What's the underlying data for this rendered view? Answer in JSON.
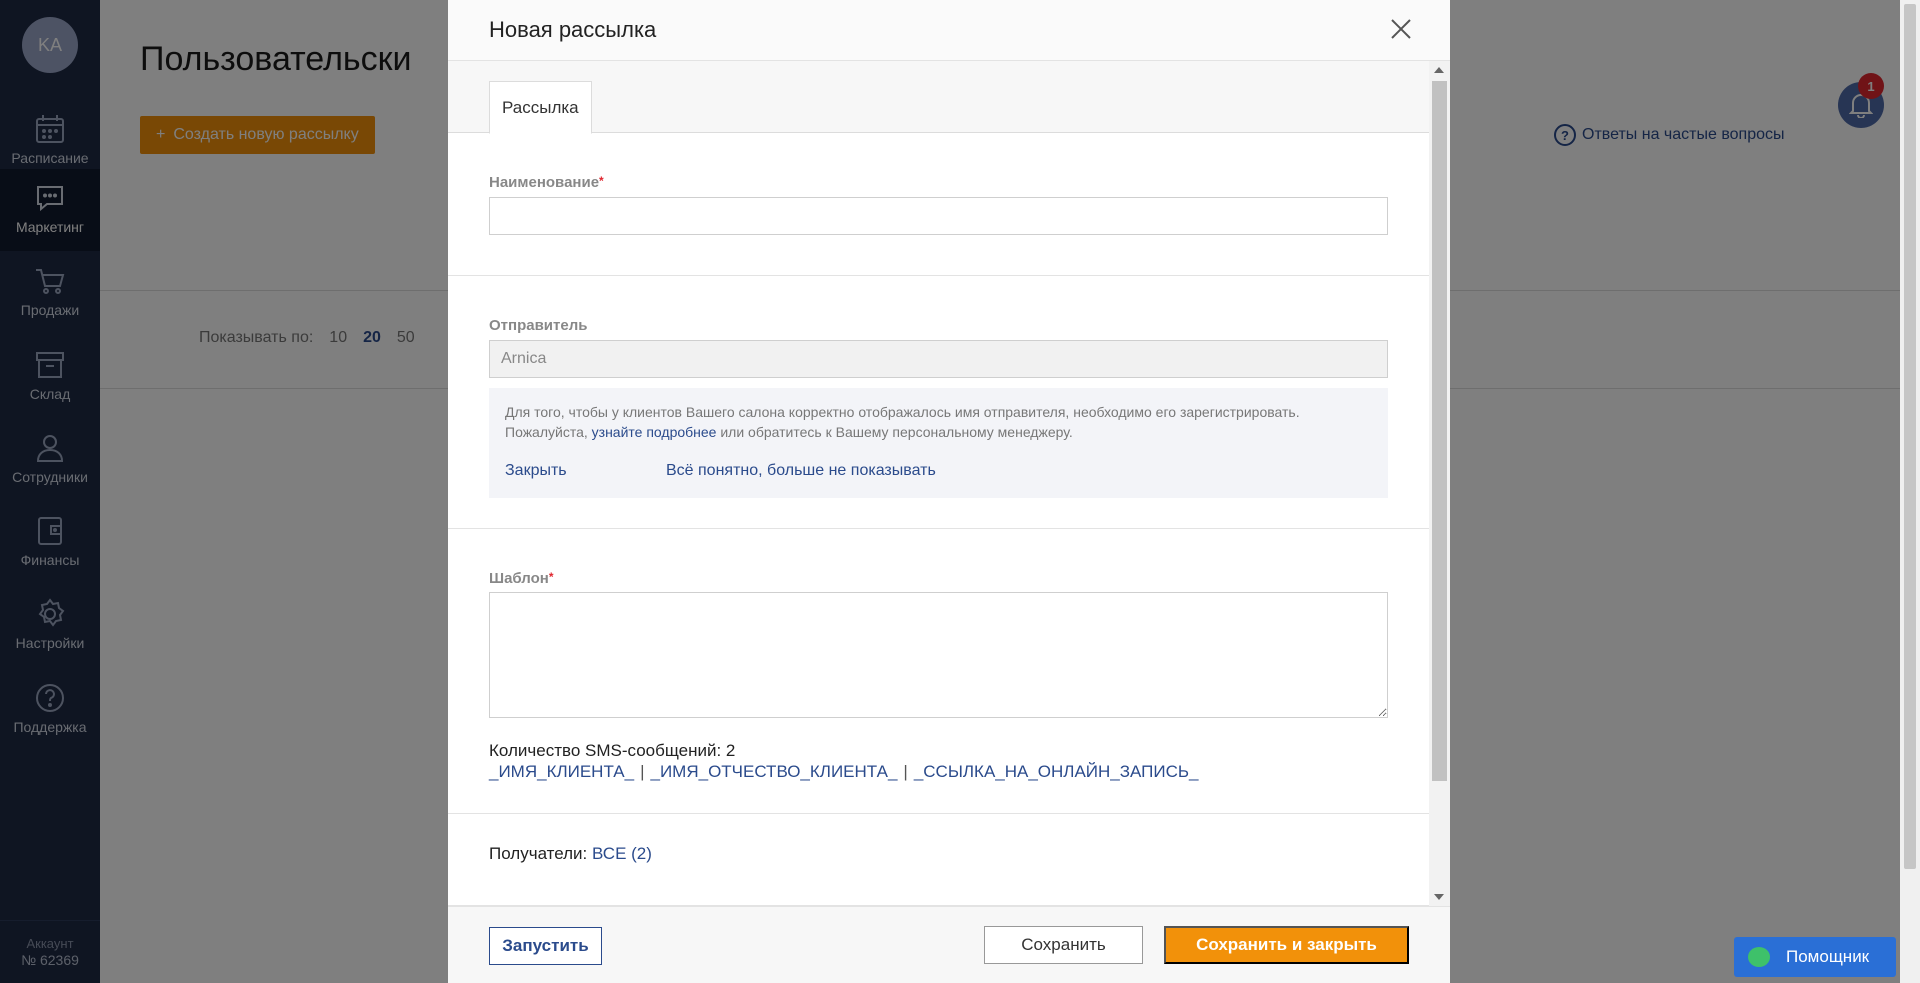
{
  "sidebar": {
    "avatar_initials": "KA",
    "items": [
      {
        "label": "Расписание",
        "icon": "calendar-icon"
      },
      {
        "label": "Маркетинг",
        "icon": "chat-icon",
        "active": true
      },
      {
        "label": "Продажи",
        "icon": "cart-icon"
      },
      {
        "label": "Склад",
        "icon": "box-icon"
      },
      {
        "label": "Сотрудники",
        "icon": "user-icon"
      },
      {
        "label": "Финансы",
        "icon": "wallet-icon"
      },
      {
        "label": "Настройки",
        "icon": "gear-icon"
      },
      {
        "label": "Поддержка",
        "icon": "help-icon"
      }
    ],
    "account_label": "Аккаунт",
    "account_number": "№ 62369"
  },
  "page": {
    "title": "Пользовательски",
    "create_button": "Создать новую рассылку",
    "faq_link": "Ответы на частые вопросы",
    "notification_count": "1",
    "per_page_label": "Показывать по:",
    "per_page_options": [
      "10",
      "20",
      "50"
    ],
    "per_page_selected": "20"
  },
  "modal": {
    "title": "Новая рассылка",
    "tab": "Рассылка",
    "name_label": "Наименование",
    "name_value": "",
    "sender_label": "Отправитель",
    "sender_value": "Arnica",
    "info_text_1": "Для того, чтобы у клиентов Вашего салона корректно отображалось имя отправителя, необходимо его зарегистрировать.",
    "info_text_2_prefix": "Пожалуйста,",
    "info_link": "узнайте подробнее",
    "info_text_2_suffix": "или обратитесь к Вашему персональному менеджеру.",
    "info_close": "Закрыть",
    "info_dismiss": "Всё понятно, больше не показывать",
    "template_label": "Шаблон",
    "template_value": "",
    "sms_count": "Количество SMS-сообщений: 2",
    "variables": [
      "_ИМЯ_КЛИЕНТА_",
      "_ИМЯ_ОТЧЕСТВО_КЛИЕНТА_",
      "_ССЫЛКА_НА_ОНЛАЙН_ЗАПИСЬ_"
    ],
    "variable_separator": "|",
    "recipients_label": "Получатели:",
    "recipients_link": "ВСЕ (2)",
    "run_button": "Запустить",
    "save_button": "Сохранить",
    "save_close_button": "Сохранить и закрыть"
  },
  "helper": {
    "label": "Помощник"
  },
  "colors": {
    "sidebar_bg": "#1f2a44",
    "accent_orange": "#f2910a",
    "link_blue": "#2b4b8c",
    "helper_blue": "#2a6fd6"
  }
}
